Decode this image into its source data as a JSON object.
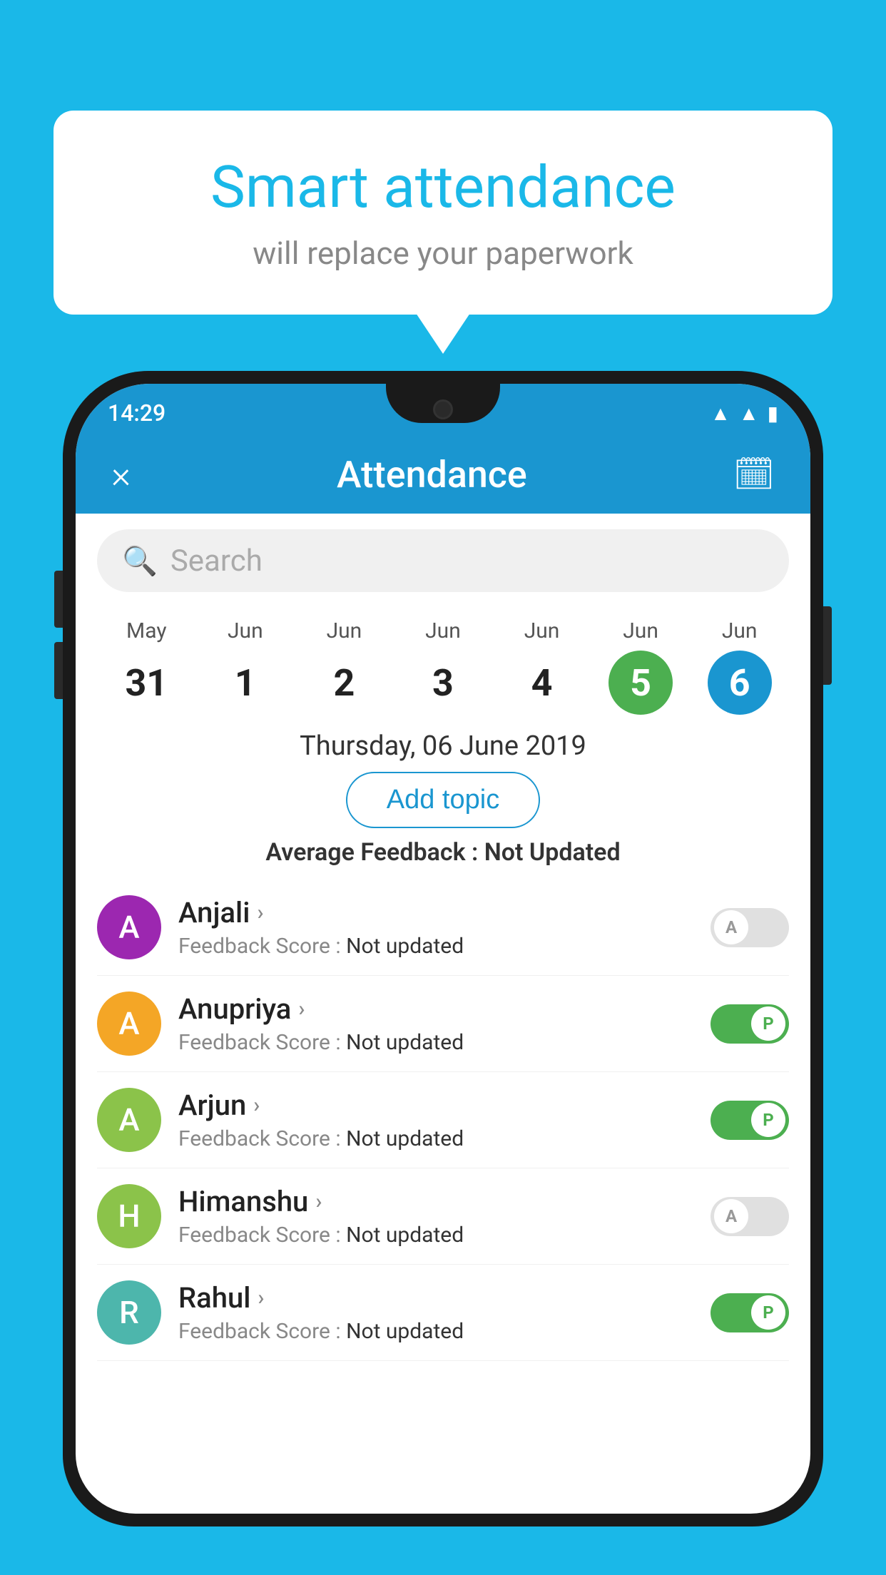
{
  "background_color": "#1ab8e8",
  "speech_bubble": {
    "title": "Smart attendance",
    "subtitle": "will replace your paperwork"
  },
  "status_bar": {
    "time": "14:29",
    "icons": [
      "wifi",
      "signal",
      "battery"
    ]
  },
  "app_header": {
    "close_label": "×",
    "title": "Attendance",
    "calendar_icon": "📅"
  },
  "search": {
    "placeholder": "Search"
  },
  "calendar": {
    "days": [
      {
        "month": "May",
        "date": "31",
        "state": "normal"
      },
      {
        "month": "Jun",
        "date": "1",
        "state": "normal"
      },
      {
        "month": "Jun",
        "date": "2",
        "state": "normal"
      },
      {
        "month": "Jun",
        "date": "3",
        "state": "normal"
      },
      {
        "month": "Jun",
        "date": "4",
        "state": "normal"
      },
      {
        "month": "Jun",
        "date": "5",
        "state": "today"
      },
      {
        "month": "Jun",
        "date": "6",
        "state": "selected"
      }
    ]
  },
  "selected_date": "Thursday, 06 June 2019",
  "add_topic_label": "Add topic",
  "avg_feedback_label": "Average Feedback : ",
  "avg_feedback_value": "Not Updated",
  "students": [
    {
      "name": "Anjali",
      "avatar_letter": "A",
      "avatar_color": "#9c27b0",
      "feedback_label": "Feedback Score : ",
      "feedback_value": "Not updated",
      "toggle_state": "off",
      "toggle_label": "A"
    },
    {
      "name": "Anupriya",
      "avatar_letter": "A",
      "avatar_color": "#f4a626",
      "feedback_label": "Feedback Score : ",
      "feedback_value": "Not updated",
      "toggle_state": "on",
      "toggle_label": "P"
    },
    {
      "name": "Arjun",
      "avatar_letter": "A",
      "avatar_color": "#8bc34a",
      "feedback_label": "Feedback Score : ",
      "feedback_value": "Not updated",
      "toggle_state": "on",
      "toggle_label": "P"
    },
    {
      "name": "Himanshu",
      "avatar_letter": "H",
      "avatar_color": "#8bc34a",
      "feedback_label": "Feedback Score : ",
      "feedback_value": "Not updated",
      "toggle_state": "off",
      "toggle_label": "A"
    },
    {
      "name": "Rahul",
      "avatar_letter": "R",
      "avatar_color": "#4db6ac",
      "feedback_label": "Feedback Score : ",
      "feedback_value": "Not updated",
      "toggle_state": "on",
      "toggle_label": "P"
    }
  ]
}
